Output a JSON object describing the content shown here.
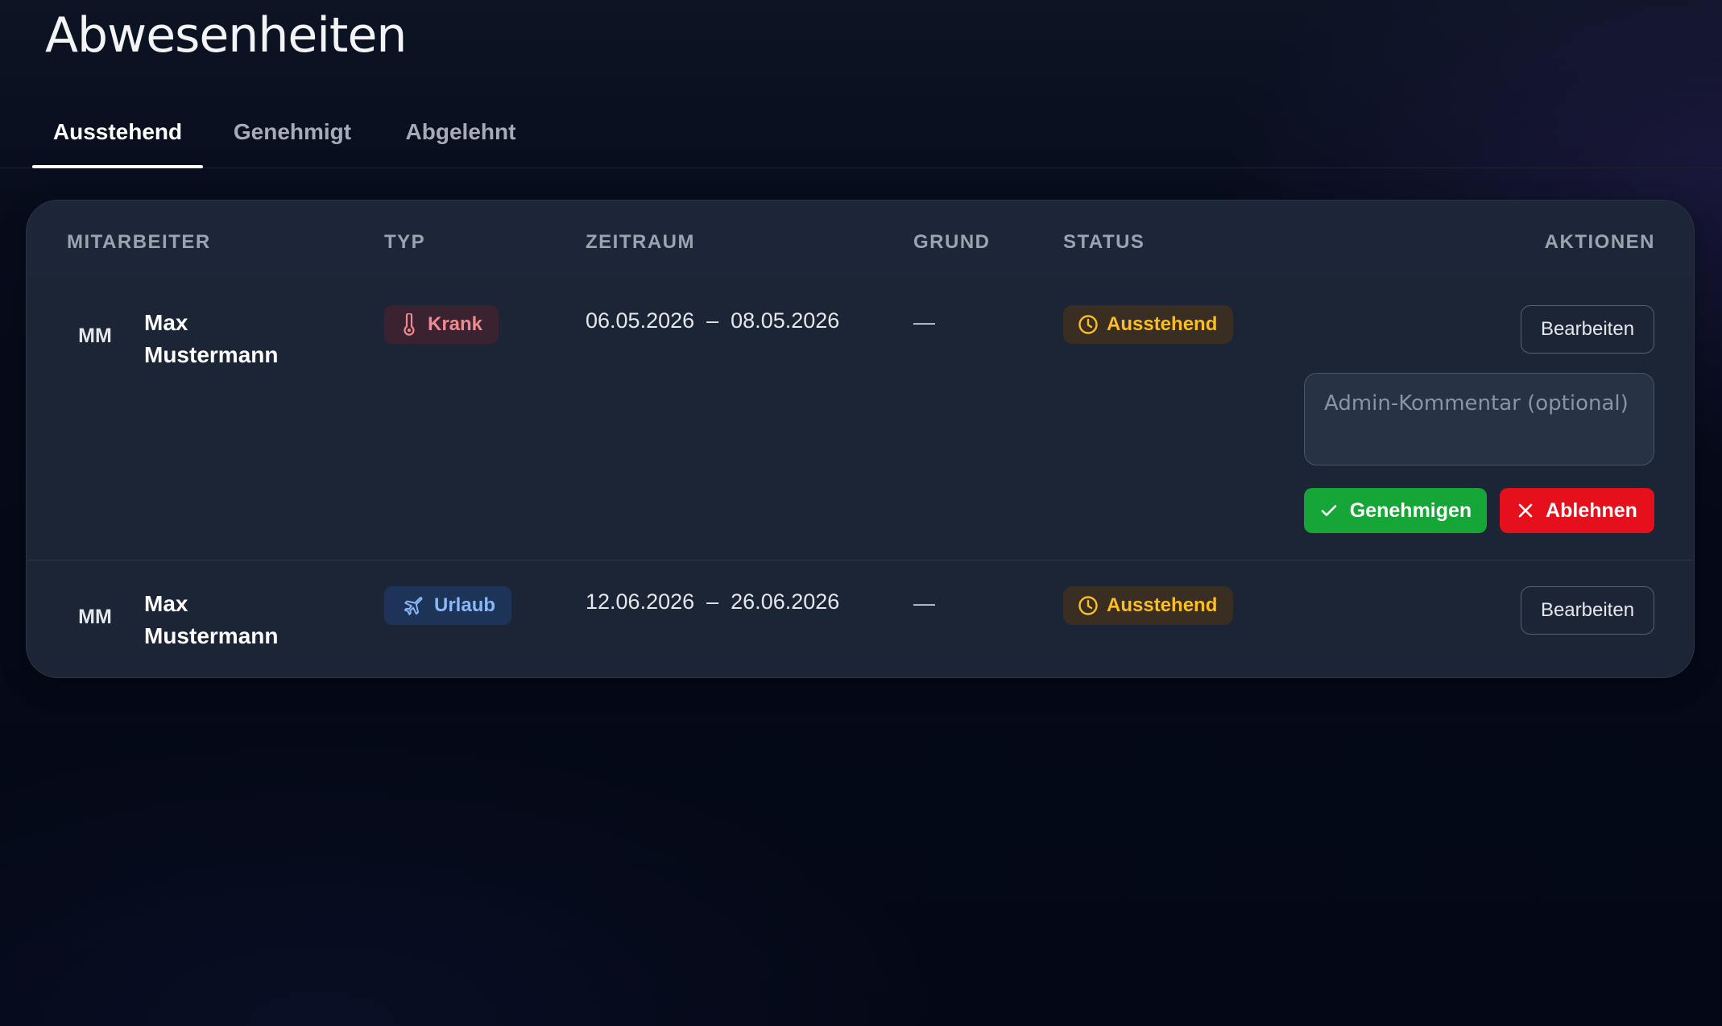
{
  "page": {
    "title": "Abwesenheiten"
  },
  "tabs": [
    {
      "label": "Ausstehend",
      "active": true
    },
    {
      "label": "Genehmigt",
      "active": false
    },
    {
      "label": "Abgelehnt",
      "active": false
    }
  ],
  "table": {
    "columns": [
      "MITARBEITER",
      "TYP",
      "ZEITRAUM",
      "GRUND",
      "STATUS",
      "AKTIONEN"
    ],
    "rows": [
      {
        "initials": "MM",
        "name": "Max Mustermann",
        "type": "Krank",
        "type_icon": "thermometer-icon",
        "date_range": "06.05.2026  –  08.05.2026",
        "reason": "—",
        "status": "Ausstehend",
        "status_icon": "clock-icon",
        "edit_label": "Bearbeiten",
        "comment_placeholder": "Admin-Kommentar (optional)",
        "approve_label": "Genehmigen",
        "reject_label": "Ablehnen"
      },
      {
        "initials": "MM",
        "name": "Max Mustermann",
        "type": "Urlaub",
        "type_icon": "airplane-icon",
        "date_range": "12.06.2026  –  26.06.2026",
        "reason": "—",
        "status": "Ausstehend",
        "status_icon": "clock-icon",
        "edit_label": "Bearbeiten"
      }
    ]
  },
  "colors": {
    "krank_badge_bg": "#3a2230",
    "krank_badge_text": "#f08a8f",
    "urlaub_badge_bg": "#1d3358",
    "urlaub_badge_text": "#8ab8f4",
    "status_pending_bg": "#3a2e23",
    "status_pending_text": "#fbbf24",
    "approve": "#16a637",
    "reject": "#e6101c"
  }
}
